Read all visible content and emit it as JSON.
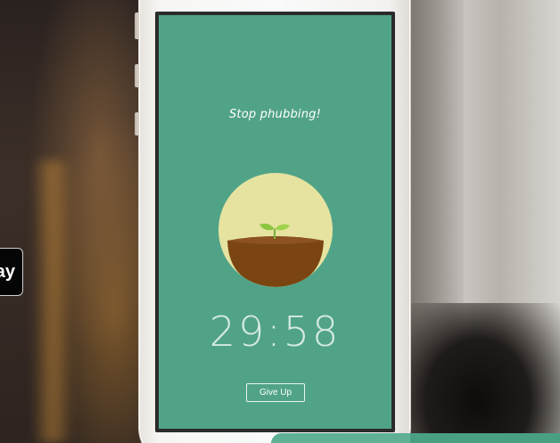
{
  "screen": {
    "tagline": "Stop phubbing!",
    "timer": "29:58",
    "give_up_label": "Give Up"
  },
  "store_badge": {
    "partial_text": "ay"
  },
  "colors": {
    "screen_green": "#51a387",
    "plant_circle": "#e6e3a1",
    "bowl_brown": "#7a4510",
    "sprout_green": "#8cc63f"
  },
  "icons": {
    "plant": "sprout-in-bowl-icon"
  }
}
